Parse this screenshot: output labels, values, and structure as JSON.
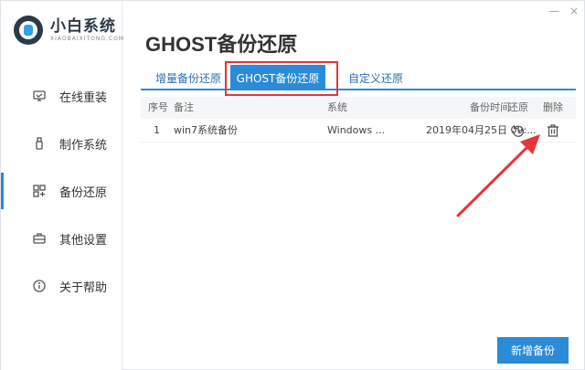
{
  "app": {
    "logo_title": "小白系统",
    "logo_subtitle": "XIAOBAIXITONG.COM",
    "window_controls": {
      "minimize": "—",
      "close": "×"
    }
  },
  "sidebar": {
    "items": [
      {
        "label": "在线重装",
        "icon": "monitor-icon",
        "active": false
      },
      {
        "label": "制作系统",
        "icon": "usb-icon",
        "active": false
      },
      {
        "label": "备份还原",
        "icon": "grid-icon",
        "active": true
      },
      {
        "label": "其他设置",
        "icon": "briefcase-icon",
        "active": false
      },
      {
        "label": "关于帮助",
        "icon": "info-icon",
        "active": false
      }
    ]
  },
  "main": {
    "title": "GHOST备份还原",
    "tabs": [
      {
        "label": "增量备份还原",
        "active": false
      },
      {
        "label": "GHOST备份还原",
        "active": true
      },
      {
        "label": "自定义还原",
        "active": false
      }
    ],
    "table": {
      "headers": {
        "no": "序号",
        "note": "备注",
        "system": "系统",
        "time": "备份时间",
        "restore": "还原",
        "delete": "删除"
      },
      "rows": [
        {
          "no": "1",
          "note": "win7系统备份",
          "system": "Windows ...",
          "time": "2019年04月25日 09:..."
        }
      ]
    },
    "add_button": "新增备份"
  },
  "colors": {
    "accent": "#2b8bd8",
    "highlight": "#e5343a",
    "text": "#333333"
  }
}
